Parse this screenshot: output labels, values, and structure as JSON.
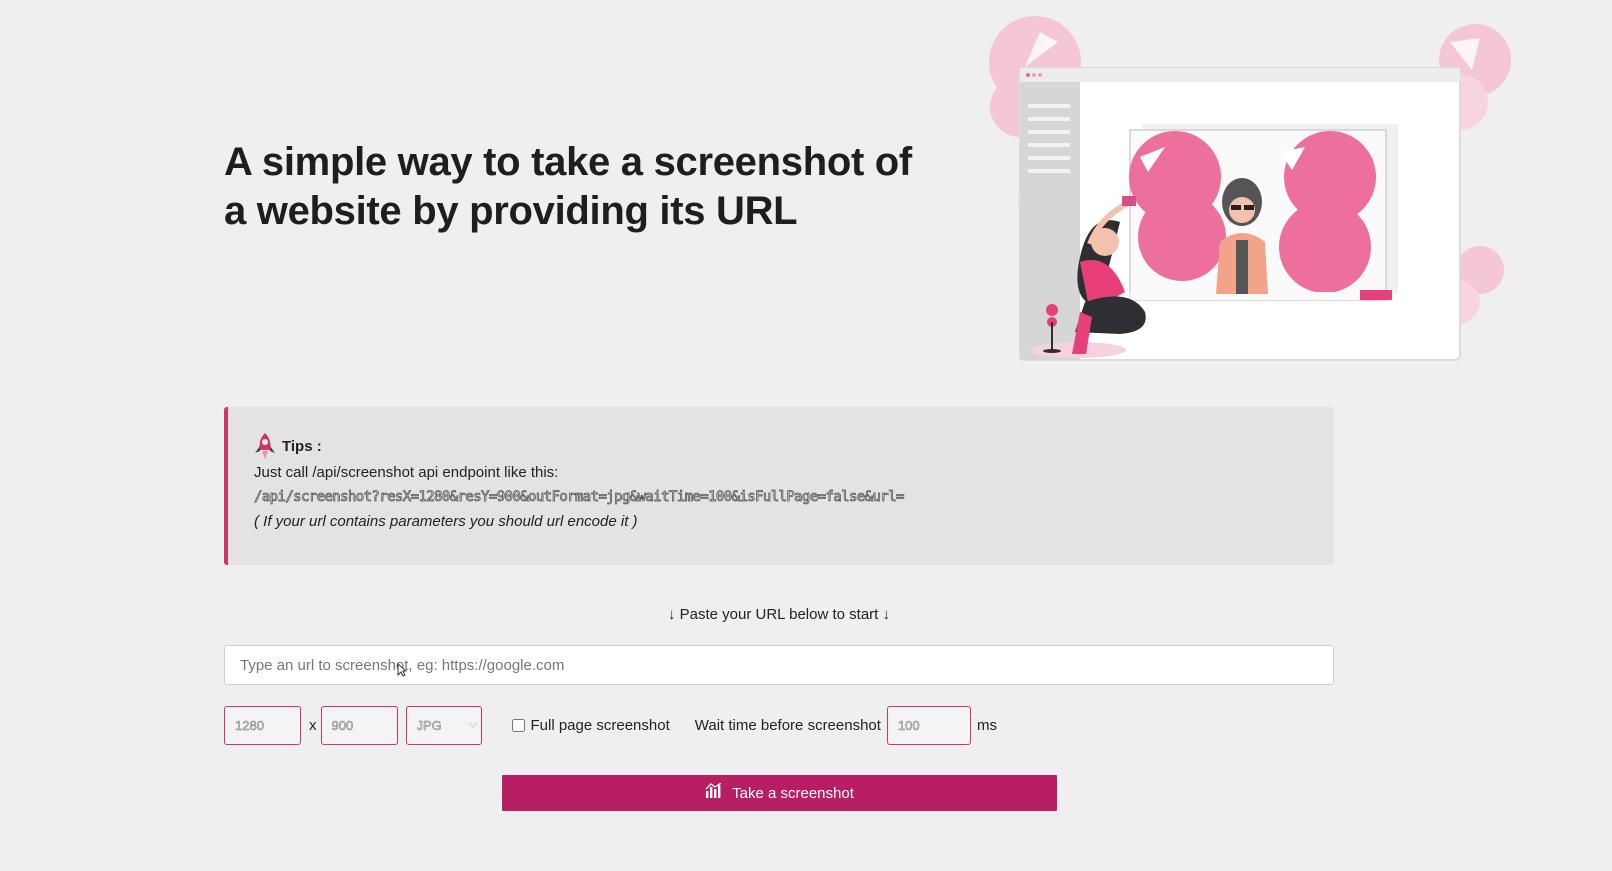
{
  "hero": {
    "title": "A simple way to take a screenshot of a website by providing its URL",
    "illustration_icon": "woman-photographing-illustration"
  },
  "tips": {
    "icon": "rocket-icon",
    "title": "Tips :",
    "intro": "Just call /api/screenshot api endpoint like this:",
    "endpoint": "/api/screenshot?resX=1280&resY=900&outFormat=jpg&waitTime=100&isFullPage=false&url=",
    "note": "( If your url contains parameters you should url encode it )"
  },
  "form": {
    "paste_hint": "↓ Paste your URL below to start ↓",
    "url_placeholder": "Type an url to screenshot, eg: https://google.com",
    "res_x": "1280",
    "res_x_separator": "x",
    "res_y": "900",
    "format": "JPG",
    "format_options": [
      "JPG"
    ],
    "full_page_label": "Full page screenshot",
    "full_page_checked": false,
    "wait_label": "Wait time before screenshot",
    "wait_value": "100",
    "wait_unit": "ms",
    "submit_label": "Take a screenshot",
    "submit_icon": "bar-chart-icon"
  },
  "colors": {
    "accent": "#b71e63",
    "tips_border": "#d23369",
    "illustration_pink": "#ec6f9d"
  }
}
